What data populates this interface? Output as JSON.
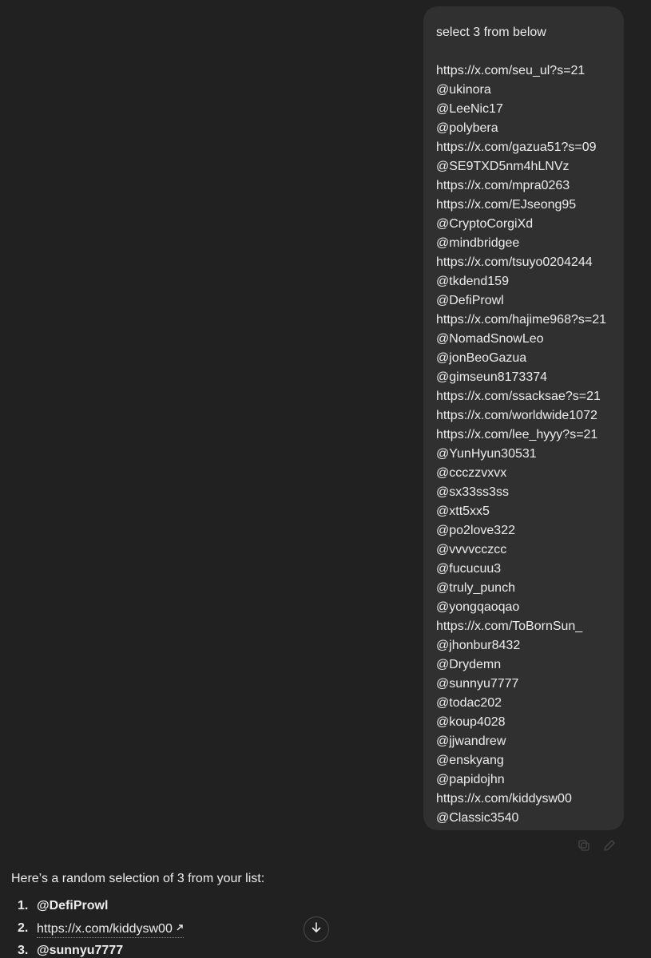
{
  "user_message": {
    "prompt": "select 3 from below",
    "handles": [
      "https://x.com/seu_ul?s=21",
      "@ukinora",
      "@LeeNic17",
      "@polybera",
      "https://x.com/gazua51?s=09",
      "@SE9TXD5nm4hLNVz",
      "https://x.com/mpra0263",
      "https://x.com/EJseong95",
      "@CryptoCorgiXd",
      "@mindbridgee",
      "https://x.com/tsuyo0204244",
      "@tkdend159",
      "@DefiProwl",
      "https://x.com/hajime968?s=21",
      "@NomadSnowLeo",
      "@jonBeoGazua",
      "@gimseun8173374",
      "https://x.com/ssacksae?s=21",
      "https://x.com/worldwide1072",
      "https://x.com/lee_hyyy?s=21",
      "@YunHyun30531",
      "@ccczzvxvx",
      "@sx33ss3ss",
      "@xtt5xx5",
      "@po2love322",
      "@vvvvcczcc",
      "@fucucuu3",
      "@truly_punch",
      "@yongqaoqao",
      "https://x.com/ToBornSun_",
      "@jhonbur8432",
      "@Drydemn",
      "@sunnyu7777",
      "@todac202",
      "@koup4028",
      "@jjwandrew",
      "@enskyang",
      "@papidojhn",
      "https://x.com/kiddysw00",
      "@Classic3540"
    ],
    "actions": [
      "copy-icon",
      "edit-icon"
    ]
  },
  "assistant_message": {
    "intro": "Here’s a random selection of 3 from your list:",
    "results": [
      {
        "number": "1.",
        "text": "@DefiProwl"
      },
      {
        "number": "2.",
        "text": "https://x.com/kiddysw00"
      },
      {
        "number": "3.",
        "text": "@sunnyu7777"
      }
    ]
  },
  "scroll_button": {
    "icon": "arrow-down-icon"
  },
  "colors": {
    "background": "#212121",
    "bubble": "#303030",
    "text": "#ececec"
  }
}
